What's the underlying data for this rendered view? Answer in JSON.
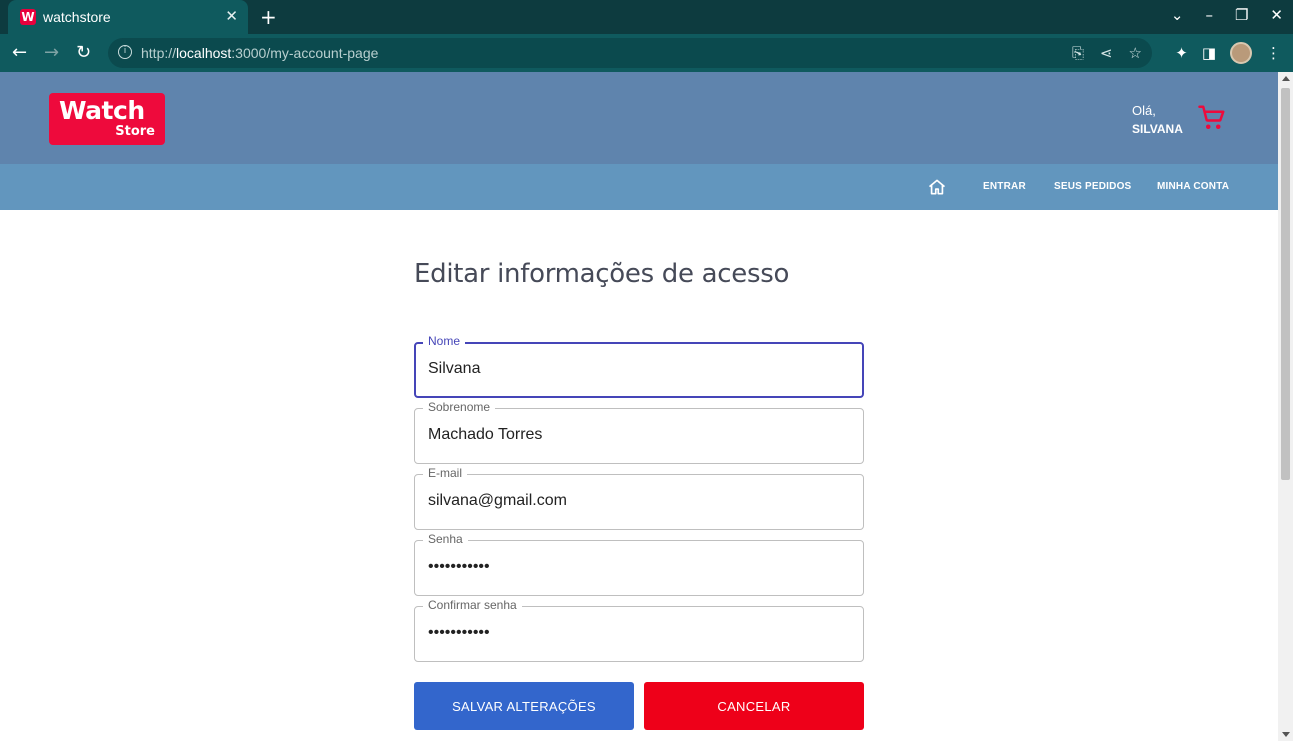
{
  "browser": {
    "tab_title": "watchstore",
    "tab_favicon": "W",
    "url_prefix": "http://",
    "url_host": "localhost",
    "url_path": ":3000/my-account-page"
  },
  "header": {
    "logo_line1": "Watch",
    "logo_line2": "Store",
    "greeting": "Olá,",
    "user_name": "SILVANA",
    "brand_color": "#ee0a3c"
  },
  "nav": {
    "links": [
      {
        "label": "ENTRAR"
      },
      {
        "label": "SEUS PEDIDOS"
      },
      {
        "label": "MINHA CONTA"
      }
    ]
  },
  "form": {
    "title": "Editar informações de acesso",
    "fields": [
      {
        "label": "Nome",
        "value": "Silvana",
        "type": "text"
      },
      {
        "label": "Sobrenome",
        "value": "Machado Torres",
        "type": "text"
      },
      {
        "label": "E-mail",
        "value": "silvana@gmail.com",
        "type": "text"
      },
      {
        "label": "Senha",
        "value": "•••••••••••",
        "type": "password"
      },
      {
        "label": "Confirmar senha",
        "value": "•••••••••••",
        "type": "password"
      }
    ],
    "save_label": "SALVAR ALTERAÇÕES",
    "cancel_label": "CANCELAR"
  }
}
